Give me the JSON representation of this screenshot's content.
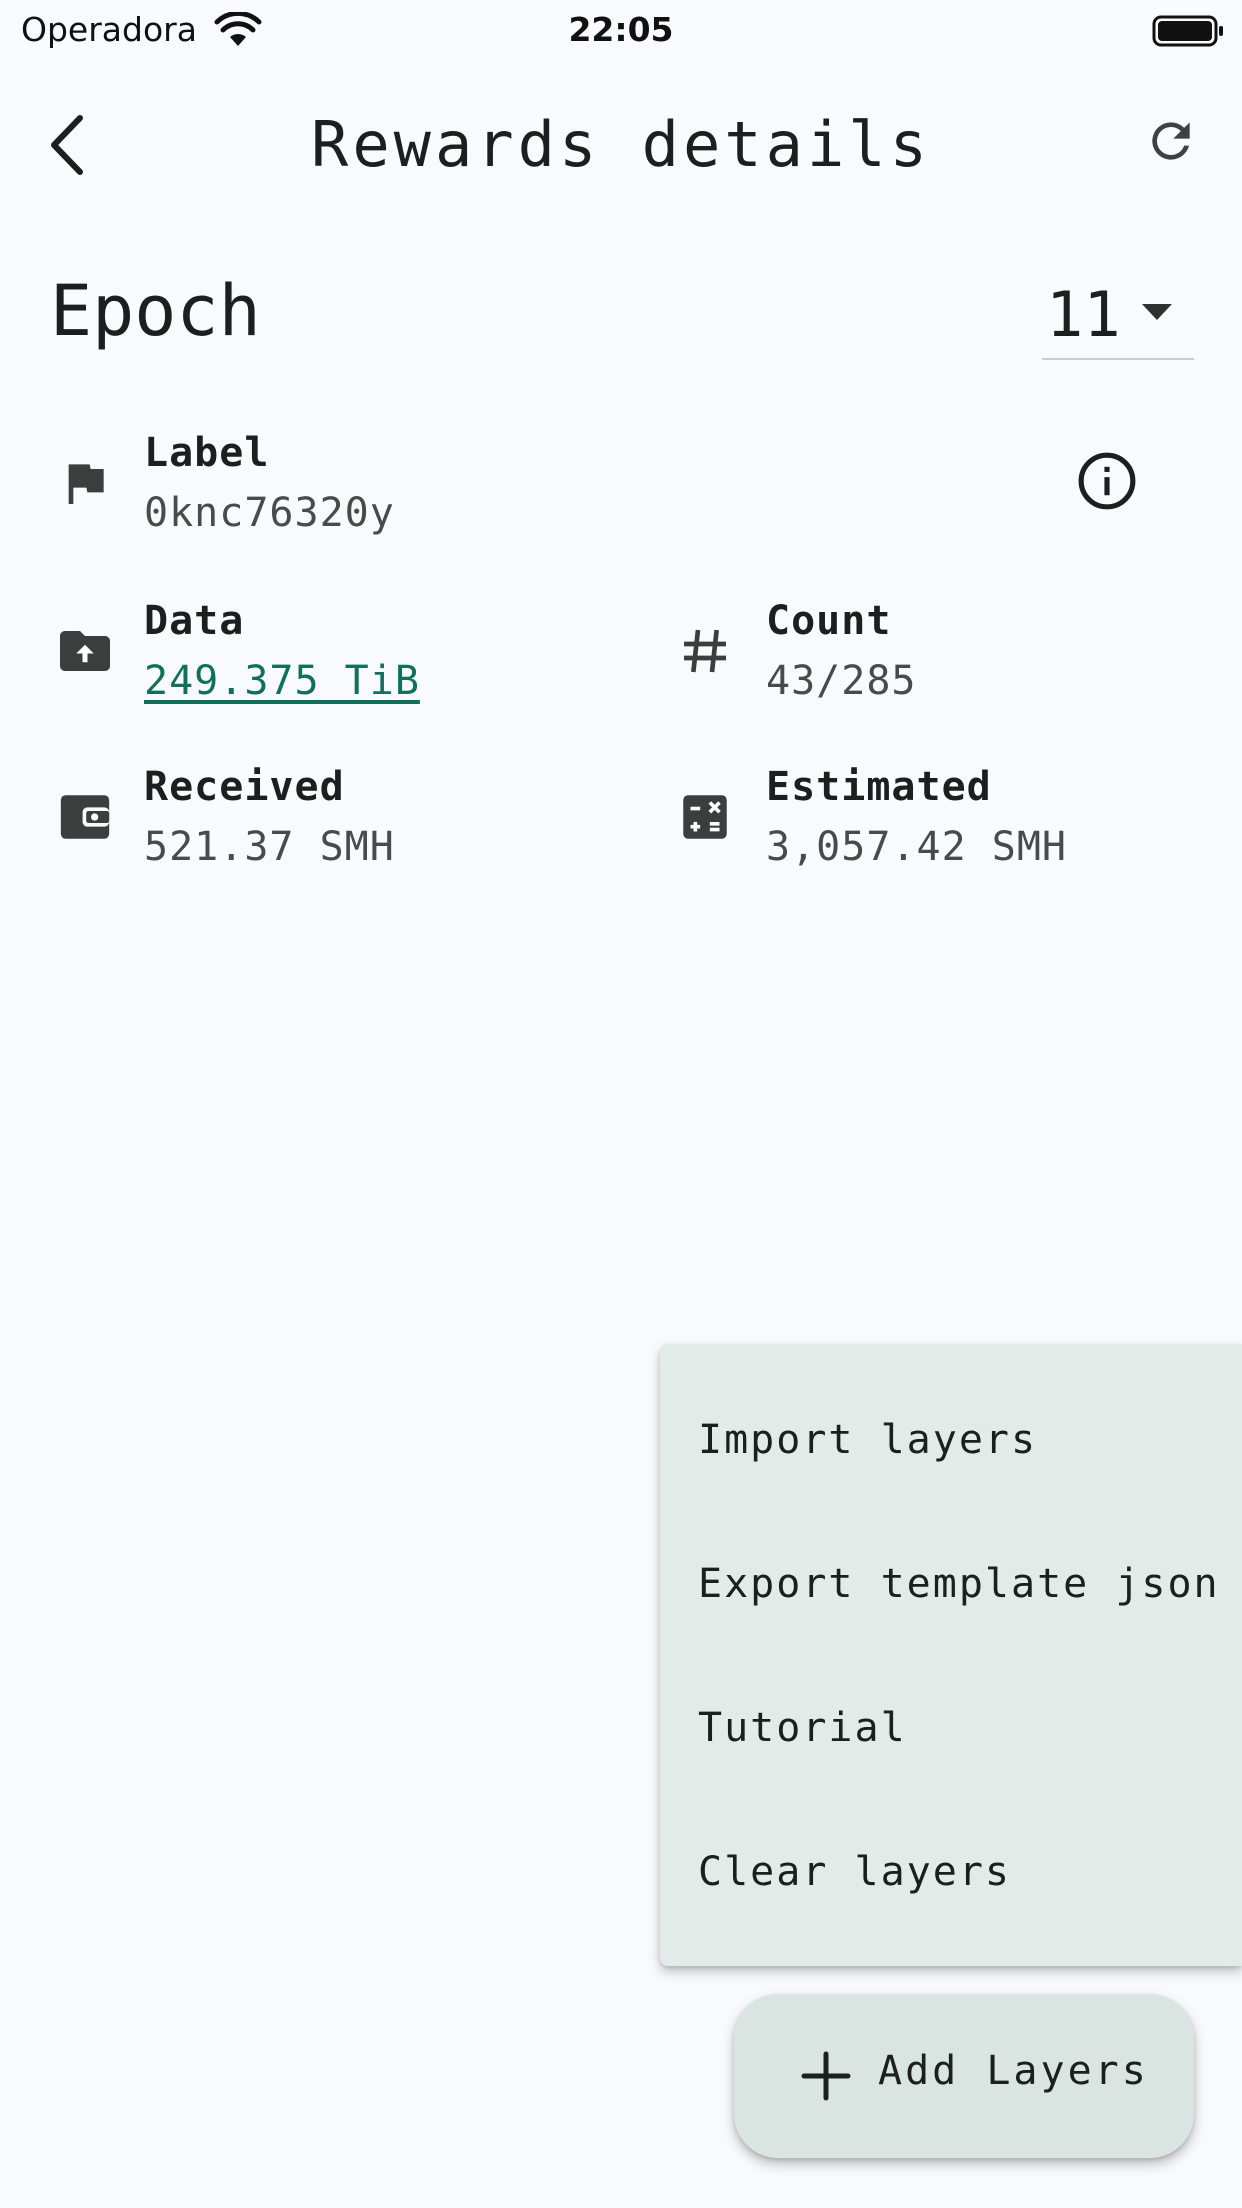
{
  "status_bar": {
    "carrier": "Operadora",
    "time": "22:05",
    "wifi_icon": "wifi-icon",
    "battery_icon": "battery-full-icon"
  },
  "app_bar": {
    "title": "Rewards details",
    "back_icon": "chevron-left-icon",
    "refresh_icon": "refresh-icon"
  },
  "epoch": {
    "label": "Epoch",
    "selected": "11",
    "dropdown_icon": "arrow-drop-down-icon"
  },
  "fields": {
    "label": {
      "title": "Label",
      "value": "0knc76320y",
      "icon": "flag-icon"
    },
    "data": {
      "title": "Data",
      "value": "249.375 TiB",
      "icon": "folder-upload-icon"
    },
    "count": {
      "title": "Count",
      "value": "43/285",
      "icon": "hash-icon"
    },
    "received": {
      "title": "Received",
      "value": "521.37 SMH",
      "icon": "wallet-icon"
    },
    "estimated": {
      "title": "Estimated",
      "value": "3,057.42 SMH",
      "icon": "calculator-icon"
    }
  },
  "info_icon": "info-icon",
  "menu": {
    "items": [
      {
        "label": "Import layers"
      },
      {
        "label": "Export template json"
      },
      {
        "label": "Tutorial"
      },
      {
        "label": "Clear layers"
      }
    ]
  },
  "fab": {
    "label": "Add Layers",
    "icon": "plus-icon"
  },
  "colors": {
    "background": "#f9fafd",
    "link": "#11705c",
    "menu_background": "#e3ebe9",
    "fab_background": "#dae4e1"
  }
}
